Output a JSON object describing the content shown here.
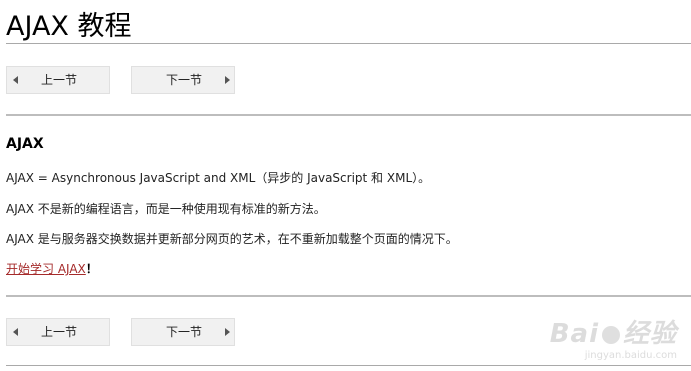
{
  "page": {
    "title": "AJAX 教程"
  },
  "nav": {
    "prev_label": "上一节",
    "next_label": "下一节"
  },
  "content": {
    "heading": "AJAX",
    "paragraphs": [
      "AJAX = Asynchronous JavaScript and XML（异步的 JavaScript 和 XML）。",
      "AJAX 不是新的编程语言，而是一种使用现有标准的新方法。",
      "AJAX 是与服务器交换数据并更新部分网页的艺术，在不重新加载整个页面的情况下。"
    ],
    "start_link": "开始学习 AJAX",
    "start_suffix": "！"
  },
  "watermark": {
    "logo_left": "Bai",
    "logo_mid": "经验",
    "url": "jingyan.baidu.com"
  },
  "colors": {
    "link": "#a52a2a",
    "button_bg": "#f1f1f1",
    "rule": "#bdbdbd"
  }
}
